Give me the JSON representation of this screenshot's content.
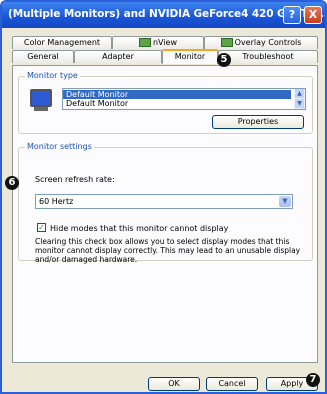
{
  "window": {
    "title": "(Multiple Monitors) and NVIDIA GeForce4 420 Go (Tos...",
    "help_label": "?",
    "close_label": "X"
  },
  "tabs": {
    "row1": [
      {
        "label": "Color Management"
      },
      {
        "label": "nView"
      },
      {
        "label": "Overlay Controls"
      }
    ],
    "row2": [
      {
        "label": "General"
      },
      {
        "label": "Adapter"
      },
      {
        "label": "Monitor"
      },
      {
        "label": "Troubleshoot"
      }
    ],
    "active": "Monitor"
  },
  "monitor_type": {
    "group_label": "Monitor type",
    "items": [
      "Default Monitor",
      "Default Monitor"
    ],
    "selected_index": 0,
    "properties_label": "Properties"
  },
  "monitor_settings": {
    "group_label": "Monitor settings",
    "refresh_label": "Screen refresh rate:",
    "refresh_value": "60 Hertz",
    "hide_modes_label": "Hide modes that this monitor cannot display",
    "hide_modes_checked": true,
    "description_lines": [
      "Clearing this check box allows you to select display modes that this",
      "monitor cannot display correctly. This may lead to an unusable display",
      "and/or damaged hardware."
    ]
  },
  "buttons": {
    "ok": "OK",
    "cancel": "Cancel",
    "apply": "Apply"
  },
  "markers": {
    "five": "5",
    "six": "6",
    "seven": "7"
  },
  "colors": {
    "titlebar": "#1a55d4",
    "selection": "#316ac5",
    "group_label": "#1c4fbd",
    "active_tab_accent": "#f5a623"
  }
}
